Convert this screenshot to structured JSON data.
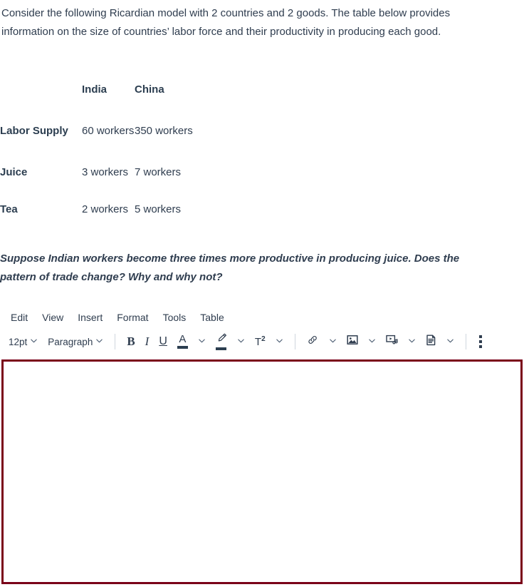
{
  "intro": {
    "text": "Consider the following Ricardian model with 2 countries and 2 goods. The table below provides information on the size of countries’ labor force and their productivity in producing each good."
  },
  "table": {
    "corner_header": "",
    "columns": [
      "India",
      "China"
    ],
    "rows": [
      {
        "label": "Labor Supply",
        "india": "60 workers",
        "china": "350 workers"
      },
      {
        "label": "Juice",
        "india": "3 workers",
        "china": "7 workers"
      },
      {
        "label": "Tea",
        "india": "2 workers",
        "china": "5 workers"
      }
    ]
  },
  "question": {
    "text": "Suppose Indian workers become three times more productive in producing juice. Does the pattern of trade change? Why and why not?"
  },
  "editor": {
    "menu": [
      {
        "label": "Edit"
      },
      {
        "label": "View"
      },
      {
        "label": "Insert"
      },
      {
        "label": "Format"
      },
      {
        "label": "Tools"
      },
      {
        "label": "Table"
      }
    ],
    "toolbar": {
      "font_size": "12pt",
      "block_format": "Paragraph",
      "bold": "B",
      "italic": "I",
      "underline": "U",
      "text_color_glyph": "A",
      "superscript_glyph": "T",
      "superscript_exponent": "2",
      "icons": {
        "font_size_chevron": "chevron-down-icon",
        "block_format_chevron": "chevron-down-icon",
        "bold": "bold-icon",
        "italic": "italic-icon",
        "underline": "underline-icon",
        "text_color": "text-color-icon",
        "highlight": "highlight-color-icon",
        "superscript": "superscript-icon",
        "link": "link-icon",
        "image": "image-icon",
        "media": "media-icon",
        "template": "document-template-icon",
        "more": "more-vertical-icon"
      }
    },
    "content": "",
    "placeholder": ""
  },
  "colors": {
    "text": "#2f3d4f",
    "heading": "#2c3e50",
    "editor_border": "#7a0019",
    "divider": "#cfd6de"
  }
}
